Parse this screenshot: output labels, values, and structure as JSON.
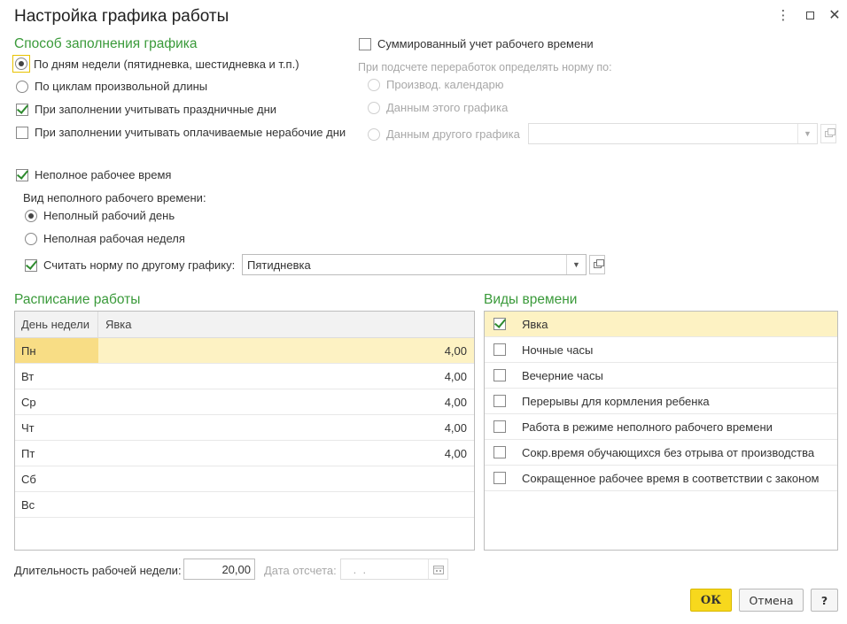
{
  "window": {
    "title": "Настройка графика работы"
  },
  "fill_method": {
    "title": "Способ заполнения графика",
    "options": [
      {
        "label": "По дням недели (пятидневка, шестидневка и т.п.)",
        "selected": true
      },
      {
        "label": "По циклам произвольной длины",
        "selected": false
      }
    ],
    "consider_holidays": {
      "label": "При заполнении учитывать праздничные дни",
      "checked": true
    },
    "consider_paid_days_off": {
      "label": "При заполнении учитывать оплачиваемые нерабочие дни",
      "checked": false
    }
  },
  "summarized": {
    "label": "Суммированный учет рабочего времени",
    "checked": false,
    "hint": "При подсчете переработок определять норму по:",
    "options": [
      {
        "label": "Производ. календарю"
      },
      {
        "label": "Данным этого графика"
      },
      {
        "label": "Данным другого графика"
      }
    ],
    "other_schedule_value": ""
  },
  "part_time": {
    "label": "Неполное рабочее время",
    "checked": true,
    "kind_label": "Вид неполного рабочего времени:",
    "options": [
      {
        "label": "Неполный рабочий день",
        "selected": true
      },
      {
        "label": "Неполная рабочая неделя",
        "selected": false
      }
    ],
    "norm_other": {
      "label": "Считать норму по другому графику:",
      "checked": true,
      "value": "Пятидневка"
    }
  },
  "schedule": {
    "title": "Расписание работы",
    "columns": [
      "День недели",
      "Явка"
    ],
    "rows": [
      {
        "day": "Пн",
        "value": "4,00"
      },
      {
        "day": "Вт",
        "value": "4,00"
      },
      {
        "day": "Ср",
        "value": "4,00"
      },
      {
        "day": "Чт",
        "value": "4,00"
      },
      {
        "day": "Пт",
        "value": "4,00"
      },
      {
        "day": "Сб",
        "value": ""
      },
      {
        "day": "Вс",
        "value": ""
      }
    ]
  },
  "time_types": {
    "title": "Виды времени",
    "items": [
      {
        "label": "Явка",
        "checked": true
      },
      {
        "label": "Ночные часы",
        "checked": false
      },
      {
        "label": "Вечерние часы",
        "checked": false
      },
      {
        "label": "Перерывы для кормления ребенка",
        "checked": false
      },
      {
        "label": "Работа в режиме неполного рабочего времени",
        "checked": false
      },
      {
        "label": "Сокр.время обучающихся без отрыва от производства",
        "checked": false
      },
      {
        "label": "Сокращенное рабочее время в соответствии с законом",
        "checked": false
      }
    ]
  },
  "footer": {
    "week_length_label": "Длительность рабочей недели:",
    "week_length_value": "20,00",
    "ref_date_label": "Дата отсчета:",
    "ref_date_value": " .  . ",
    "ok_label": "ОК",
    "cancel_label": "Отмена",
    "help_label": "?"
  },
  "icons": {
    "more": "more-vertical-icon",
    "maximize": "maximize-icon",
    "close": "close-icon",
    "dropdown": "chevron-down-icon",
    "open": "open-external-icon",
    "calendar": "calendar-icon"
  }
}
